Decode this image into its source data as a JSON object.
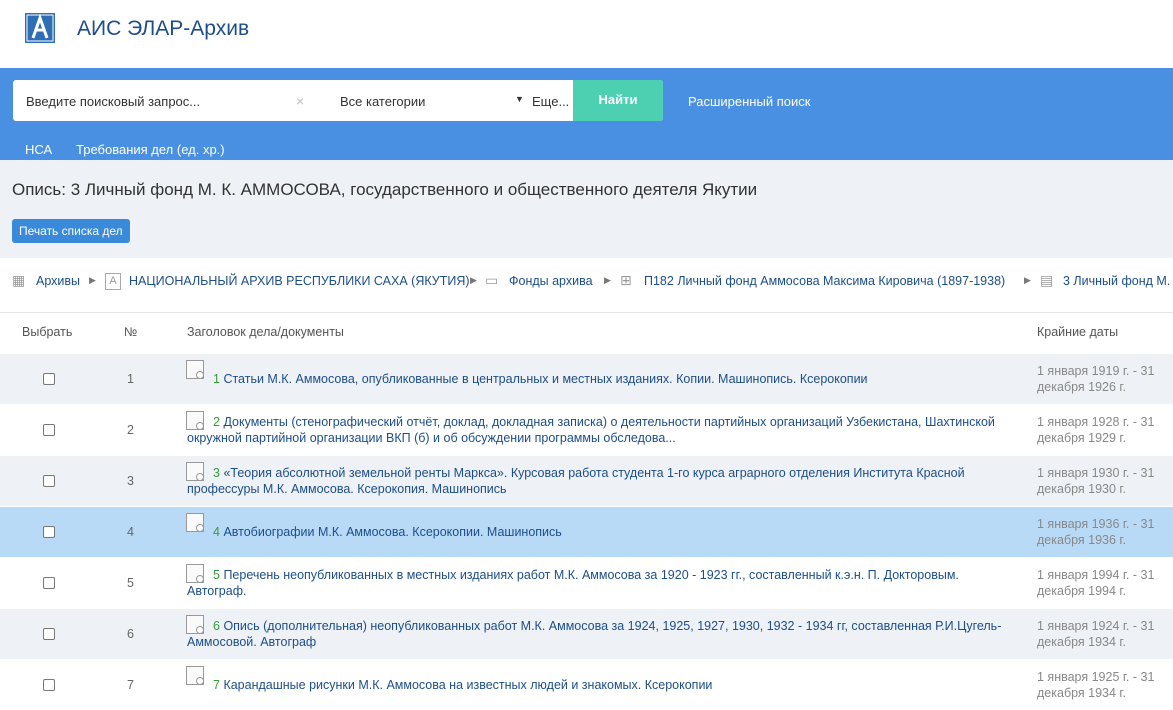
{
  "app": {
    "title": "АИС ЭЛАР-Архив"
  },
  "search": {
    "placeholder": "Введите поисковый запрос...",
    "clear": "×",
    "category": "Все категории",
    "more": "Еще...",
    "find_label": "Найти",
    "advanced_label": "Расширенный поиск"
  },
  "nav": {
    "item1": "НСА",
    "item2": "Требования дел (ед. хр.)"
  },
  "page": {
    "title": "Опись: 3 Личный фонд М. К. АММОСОВА, государственного и общественного деятеля Якутии",
    "print_label": "Печать списка дел"
  },
  "breadcrumbs": {
    "c1": "Архивы",
    "c2": "НАЦИОНАЛЬНЫЙ АРХИВ РЕСПУБЛИКИ САХА (ЯКУТИЯ)",
    "c3": "Фонды архива",
    "c4": "П182 Личный фонд Аммосова Максима Кировича (1897-1938)",
    "c5": "3 Личный фонд М."
  },
  "table": {
    "headers": {
      "select": "Выбрать",
      "num": "№",
      "title": "Заголовок дела/документы",
      "dates": "Крайние даты"
    },
    "rows": [
      {
        "num": "1",
        "case_num": "1",
        "title": "Статьи М.К. Аммосова, опубликованные в центральных и местных изданиях. Копии. Машинопись. Ксерокопии",
        "dates": "1 января 1919 г. - 31 декабря 1926 г."
      },
      {
        "num": "2",
        "case_num": "2",
        "title": "Документы (стенографический отчёт, доклад, докладная записка) о деятельности партийных организаций Узбекистана, Шахтинской окружной партийной организации ВКП (б) и об обсуждении программы обследова...",
        "dates": "1 января 1928 г. - 31 декабря 1929 г."
      },
      {
        "num": "3",
        "case_num": "3",
        "title": "«Теория абсолютной земельной ренты Маркса». Курсовая работа студента 1-го курса аграрного отделения Института Красной профессуры М.К. Аммосова. Ксерокопия. Машинопись",
        "dates": "1 января 1930 г. - 31 декабря 1930 г."
      },
      {
        "num": "4",
        "case_num": "4",
        "title": "Автобиографии М.К. Аммосова. Ксерокопии. Машинопись",
        "dates": "1 января 1936 г. - 31 декабря 1936 г."
      },
      {
        "num": "5",
        "case_num": "5",
        "title": "Перечень неопубликованных в местных изданиях работ М.К. Аммосова за 1920 - 1923 гг., составленный к.э.н. П. Докторовым. Автограф.",
        "dates": "1 января 1994 г. - 31 декабря 1994 г."
      },
      {
        "num": "6",
        "case_num": "6",
        "title": "Опись (дополнительная) неопубликованных работ М.К. Аммосова за 1924, 1925, 1927, 1930, 1932 - 1934 гг, составленная Р.И.Цугель-Аммосовой. Автограф",
        "dates": "1 января 1924 г. - 31 декабря 1934 г."
      },
      {
        "num": "7",
        "case_num": "7",
        "title": "Карандашные рисунки М.К. Аммосова на известных людей и знакомых. Ксерокопии",
        "dates": "1 января 1925 г. - 31 декабря 1934 г."
      }
    ]
  },
  "colors": {
    "header_blue": "#4a90e2",
    "find_green": "#4dd0b1",
    "highlight_row": "#b9daf7",
    "link": "#1d4e8a"
  }
}
